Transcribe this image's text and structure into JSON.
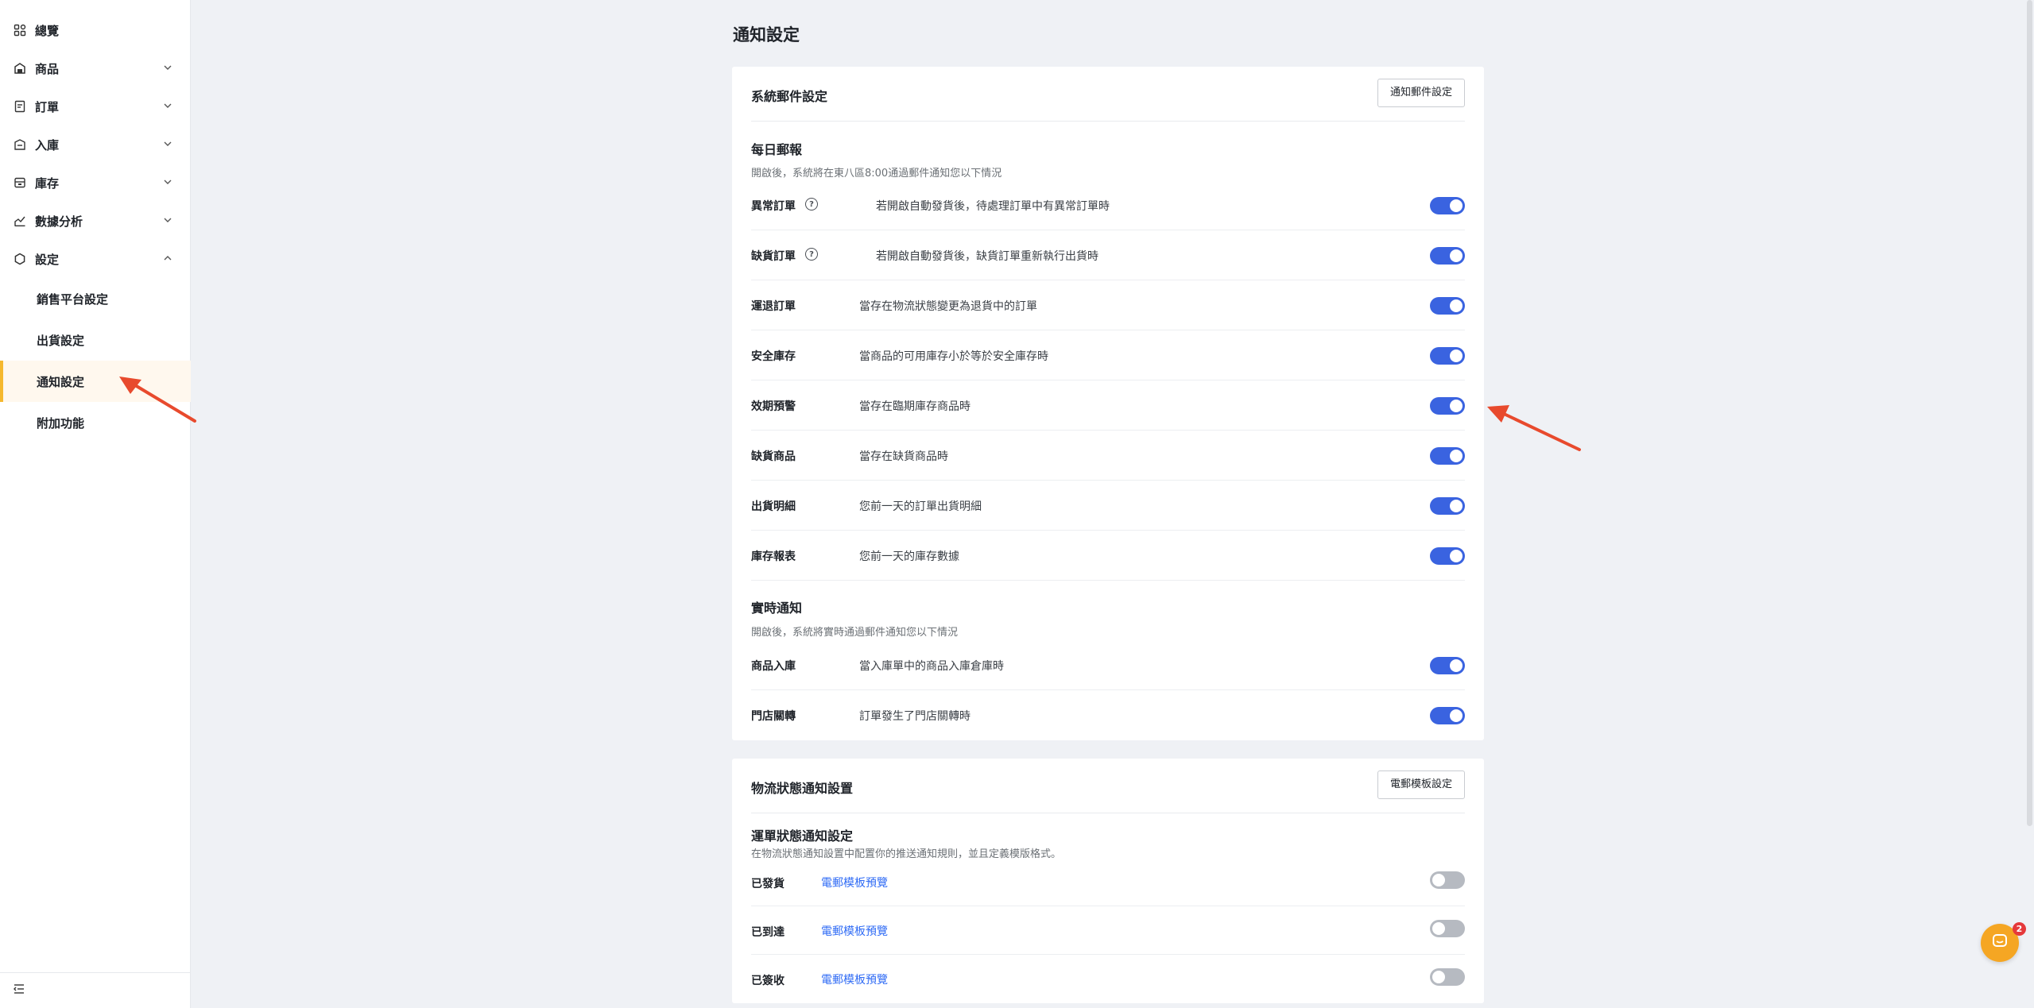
{
  "sidebar": {
    "items": [
      {
        "label": "總覽",
        "icon": "overview-grid-icon"
      },
      {
        "label": "商品",
        "icon": "product-box-icon"
      },
      {
        "label": "訂單",
        "icon": "order-list-icon"
      },
      {
        "label": "入庫",
        "icon": "inbound-icon"
      },
      {
        "label": "庫存",
        "icon": "inventory-icon"
      },
      {
        "label": "數據分析",
        "icon": "analytics-icon"
      },
      {
        "label": "設定",
        "icon": "settings-hexagon-icon"
      }
    ],
    "settings_sub": [
      "銷售平台設定",
      "出貨設定",
      "通知設定",
      "附加功能"
    ],
    "active_sub": "通知設定",
    "collapse_icon": "collapse-menu-icon"
  },
  "page": {
    "title": "通知設定"
  },
  "email_card": {
    "title": "系統郵件設定",
    "button": "通知郵件設定",
    "daily": {
      "title": "每日郵報",
      "desc": "開啟後，系統將在東八區8:00通過郵件通知您以下情況",
      "rows": [
        {
          "label": "異常訂單",
          "help": "?",
          "desc": "若開啟自動發貨後，待處理訂單中有異常訂單時",
          "enabled": true
        },
        {
          "label": "缺貨訂單",
          "help": "?",
          "desc": "若開啟自動發貨後，缺貨訂單重新執行出貨時",
          "enabled": true
        },
        {
          "label": "運退訂單",
          "desc": "當存在物流狀態變更為退貨中的訂單",
          "enabled": true
        },
        {
          "label": "安全庫存",
          "desc": "當商品的可用庫存小於等於安全庫存時",
          "enabled": true
        },
        {
          "label": "效期預警",
          "desc": "當存在臨期庫存商品時",
          "enabled": true
        },
        {
          "label": "缺貨商品",
          "desc": "當存在缺貨商品時",
          "enabled": true
        },
        {
          "label": "出貨明細",
          "desc": "您前一天的訂單出貨明細",
          "enabled": true
        },
        {
          "label": "庫存報表",
          "desc": "您前一天的庫存數據",
          "enabled": true
        }
      ]
    },
    "realtime": {
      "title": "實時通知",
      "desc": "開啟後，系統將實時通過郵件通知您以下情況",
      "rows": [
        {
          "label": "商品入庫",
          "desc": "當入庫單中的商品入庫倉庫時",
          "enabled": true
        },
        {
          "label": "門店關轉",
          "desc": "訂單發生了門店關轉時",
          "enabled": true
        }
      ]
    }
  },
  "logistics_card": {
    "title": "物流狀態通知設置",
    "button": "電郵模板設定",
    "section": {
      "title": "運單狀態通知設定",
      "desc": "在物流狀態通知設置中配置你的推送通知規則，並且定義模版格式。",
      "rows": [
        {
          "label": "已發貨",
          "link": "電郵模板預覽",
          "enabled": false
        },
        {
          "label": "已到達",
          "link": "電郵模板預覽",
          "enabled": false
        },
        {
          "label": "已簽收",
          "link": "電郵模板預覽",
          "enabled": false
        }
      ]
    }
  },
  "chat": {
    "badge": "2",
    "icon": "chat-bubble-icon"
  },
  "colors": {
    "toggle_on": "#3a63e0",
    "toggle_off": "#b6bac1",
    "active_accent": "#f5b82e",
    "link": "#2f6bf5",
    "annotation_arrow": "#e84a2d",
    "chat": "#f5a623"
  }
}
